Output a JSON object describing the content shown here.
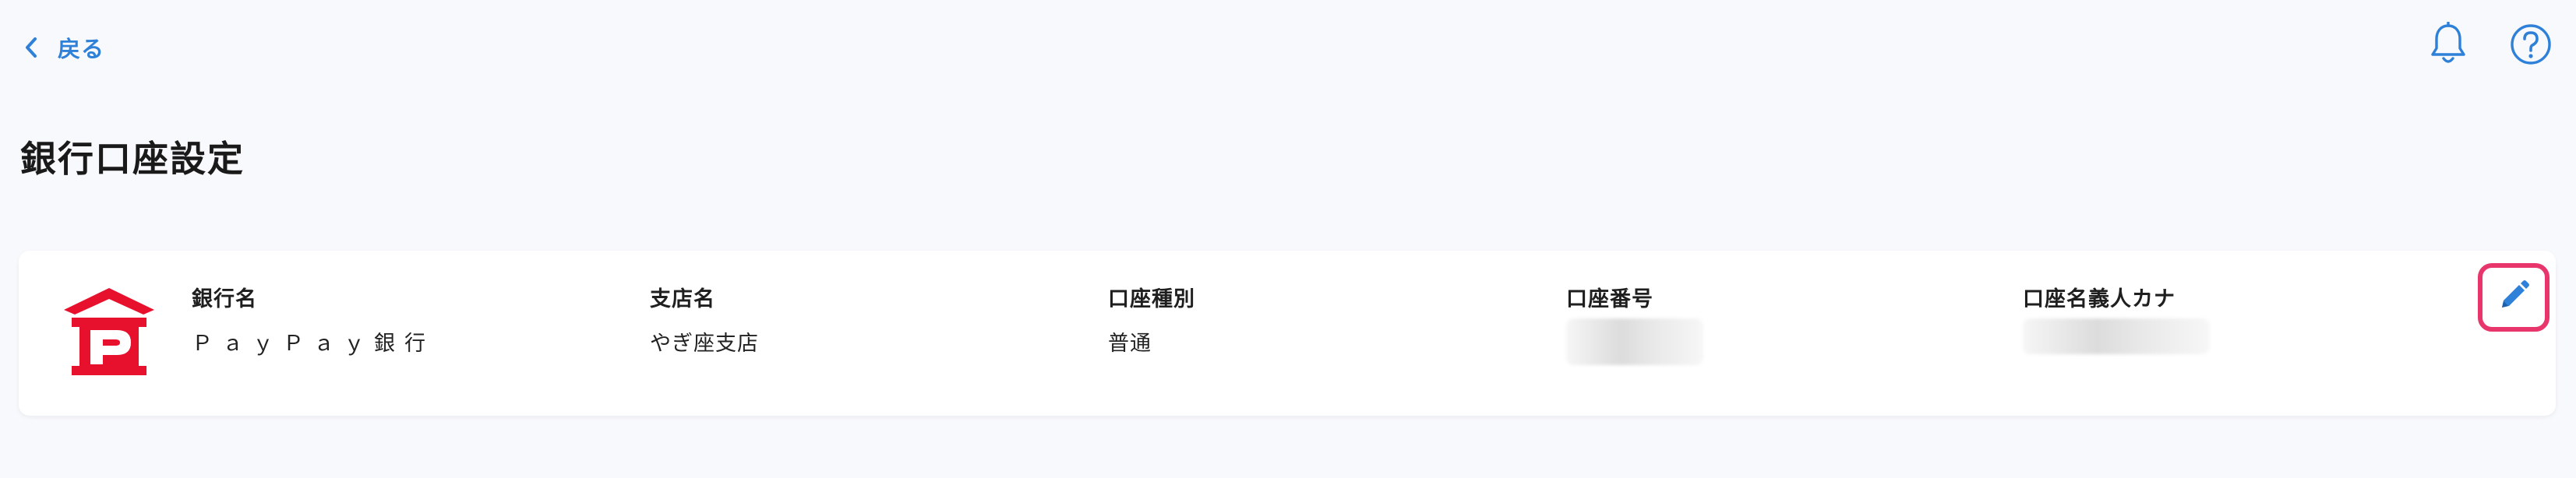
{
  "header": {
    "back_label": "戻る",
    "icons": [
      "chevron-left-icon",
      "bell-icon",
      "help-icon"
    ]
  },
  "page": {
    "title": "銀行口座設定"
  },
  "account_card": {
    "logo_icon": "paypay-bank-logo",
    "fields": {
      "bank_name": {
        "label": "銀行名",
        "value": "ＰａｙＰａｙ銀行"
      },
      "branch_name": {
        "label": "支店名",
        "value": "やぎ座支店"
      },
      "account_type": {
        "label": "口座種別",
        "value": "普通"
      },
      "account_number": {
        "label": "口座番号"
      },
      "holder_kana": {
        "label": "口座名義人カナ"
      }
    },
    "edit_icon": "pencil-icon"
  },
  "colors": {
    "accent": "#2f80d8",
    "brand_red": "#e8112d",
    "highlight": "#e8356b",
    "background": "#f8f9fc"
  }
}
